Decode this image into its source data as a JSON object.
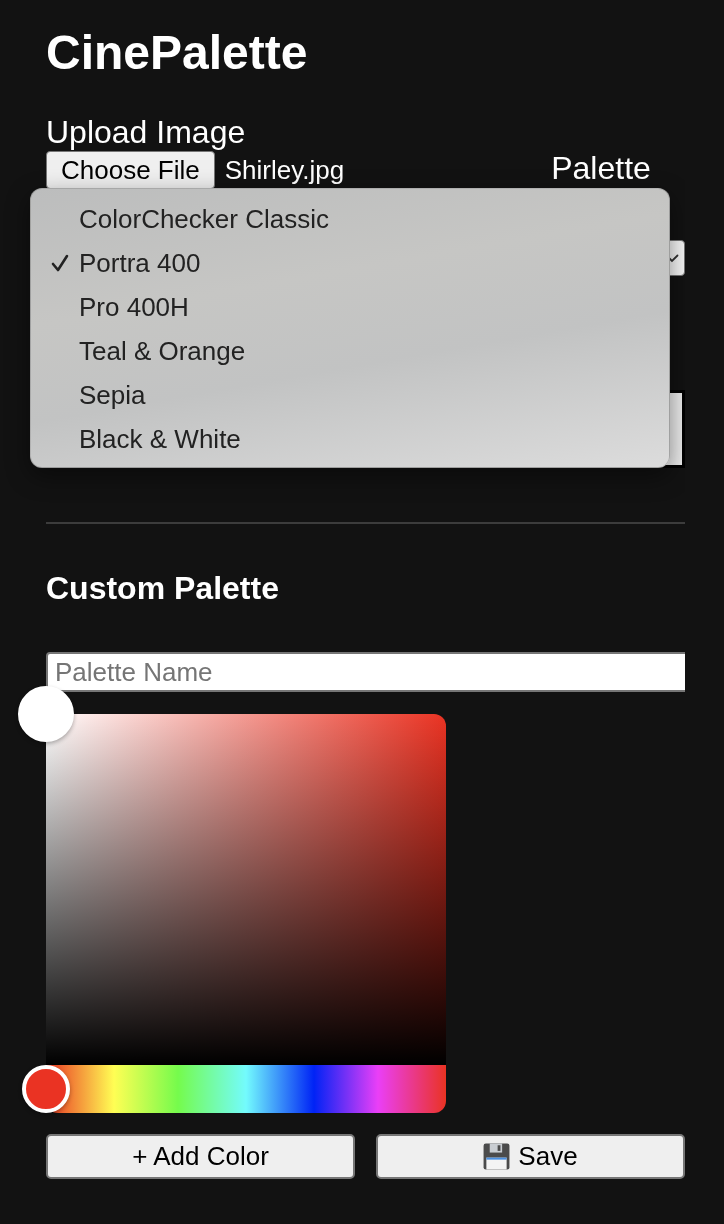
{
  "app_title": "CinePalette",
  "upload": {
    "label": "Upload Image",
    "button": "Choose File",
    "file_name": "Shirley.jpg"
  },
  "palette": {
    "label": "Palette",
    "select": {
      "open": true,
      "options": [
        {
          "label": "ColorChecker Classic",
          "selected": false
        },
        {
          "label": "Portra 400",
          "selected": true
        },
        {
          "label": "Pro 400H",
          "selected": false
        },
        {
          "label": "Teal & Orange",
          "selected": false
        },
        {
          "label": "Sepia",
          "selected": false
        },
        {
          "label": "Black & White",
          "selected": false
        }
      ]
    }
  },
  "custom_palette": {
    "title": "Custom Palette",
    "name_field": {
      "placeholder": "Palette Name"
    },
    "color_picker": {
      "saturation": {
        "level": 0
      },
      "blackness": {
        "level": 0
      },
      "hue": {
        "level": 0
      }
    },
    "buttons": [
      {
        "kind": "add",
        "label": "+ Add Color"
      },
      {
        "kind": "save",
        "label": "Save"
      }
    ]
  }
}
